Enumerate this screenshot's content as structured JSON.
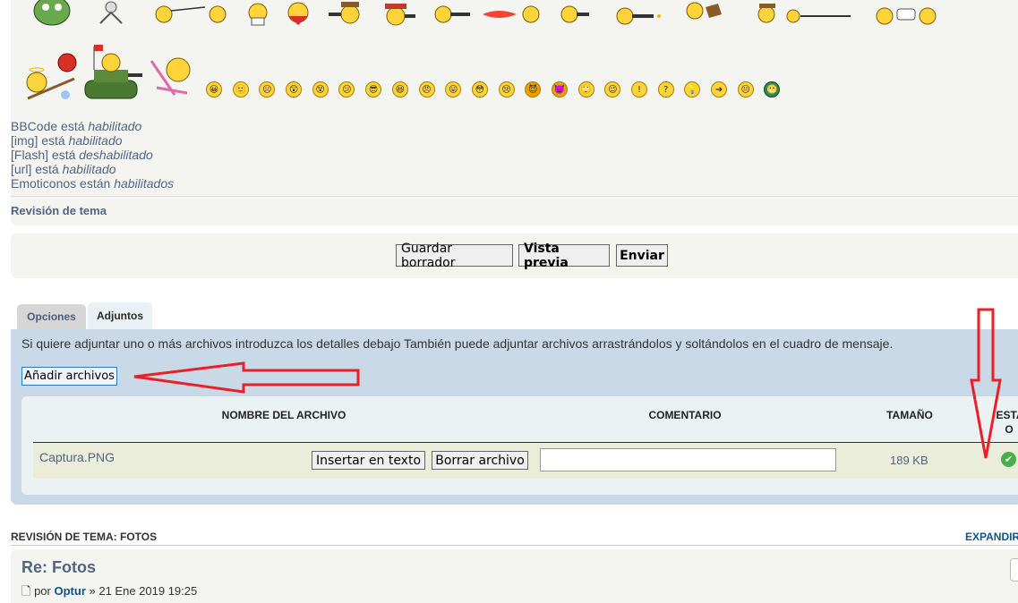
{
  "smilies": {
    "row1_count": 13,
    "row2_big": [
      "angel-seesaw-icon",
      "tank-icon",
      "beach-chair-icon"
    ],
    "small_count": 22
  },
  "bbcode_status": [
    {
      "label": "BBCode está",
      "status": "habilitado"
    },
    {
      "label": "[img] está",
      "status": "habilitado"
    },
    {
      "label": "[Flash] está",
      "status": "deshabilitado"
    },
    {
      "label": "[url] está",
      "status": "habilitado"
    },
    {
      "label": "Emoticonos están",
      "status": "habilitados"
    }
  ],
  "topic_review_link": "Revisión de tema",
  "buttons": {
    "save_draft": "Guardar borrador",
    "preview": "Vista previa",
    "submit": "Enviar"
  },
  "tabs": [
    {
      "label": "Opciones",
      "active": false
    },
    {
      "label": "Adjuntos",
      "active": true
    }
  ],
  "attachments": {
    "intro": "Si quiere adjuntar uno o más archivos introduzca los detalles debajo También puede adjuntar archivos arrastrándolos y soltándolos en el cuadro de mensaje.",
    "add_files": "Añadir archivos",
    "columns": {
      "filename": "NOMBRE DEL ARCHIVO",
      "comment": "COMENTARIO",
      "size": "TAMAÑO",
      "status_line1": "ESTA",
      "status_line2": "O"
    },
    "files": [
      {
        "name": "Captura.PNG",
        "insert": "Insertar en texto",
        "delete": "Borrar archivo",
        "comment": "",
        "size": "189 KB",
        "status": "ok"
      }
    ]
  },
  "review": {
    "heading": "REVISIÓN DE TEMA: FOTOS",
    "expand": "EXPANDIR",
    "post_title": "Re: Fotos",
    "post_by": "por",
    "post_author": "Optur",
    "post_date": "» 21 Ene 2019 19:25"
  },
  "colors": {
    "panel_bg": "#f4f5f1",
    "attach_bg": "#c9d9e7",
    "link_blue": "#536482",
    "annotation_red": "#e8202a"
  }
}
